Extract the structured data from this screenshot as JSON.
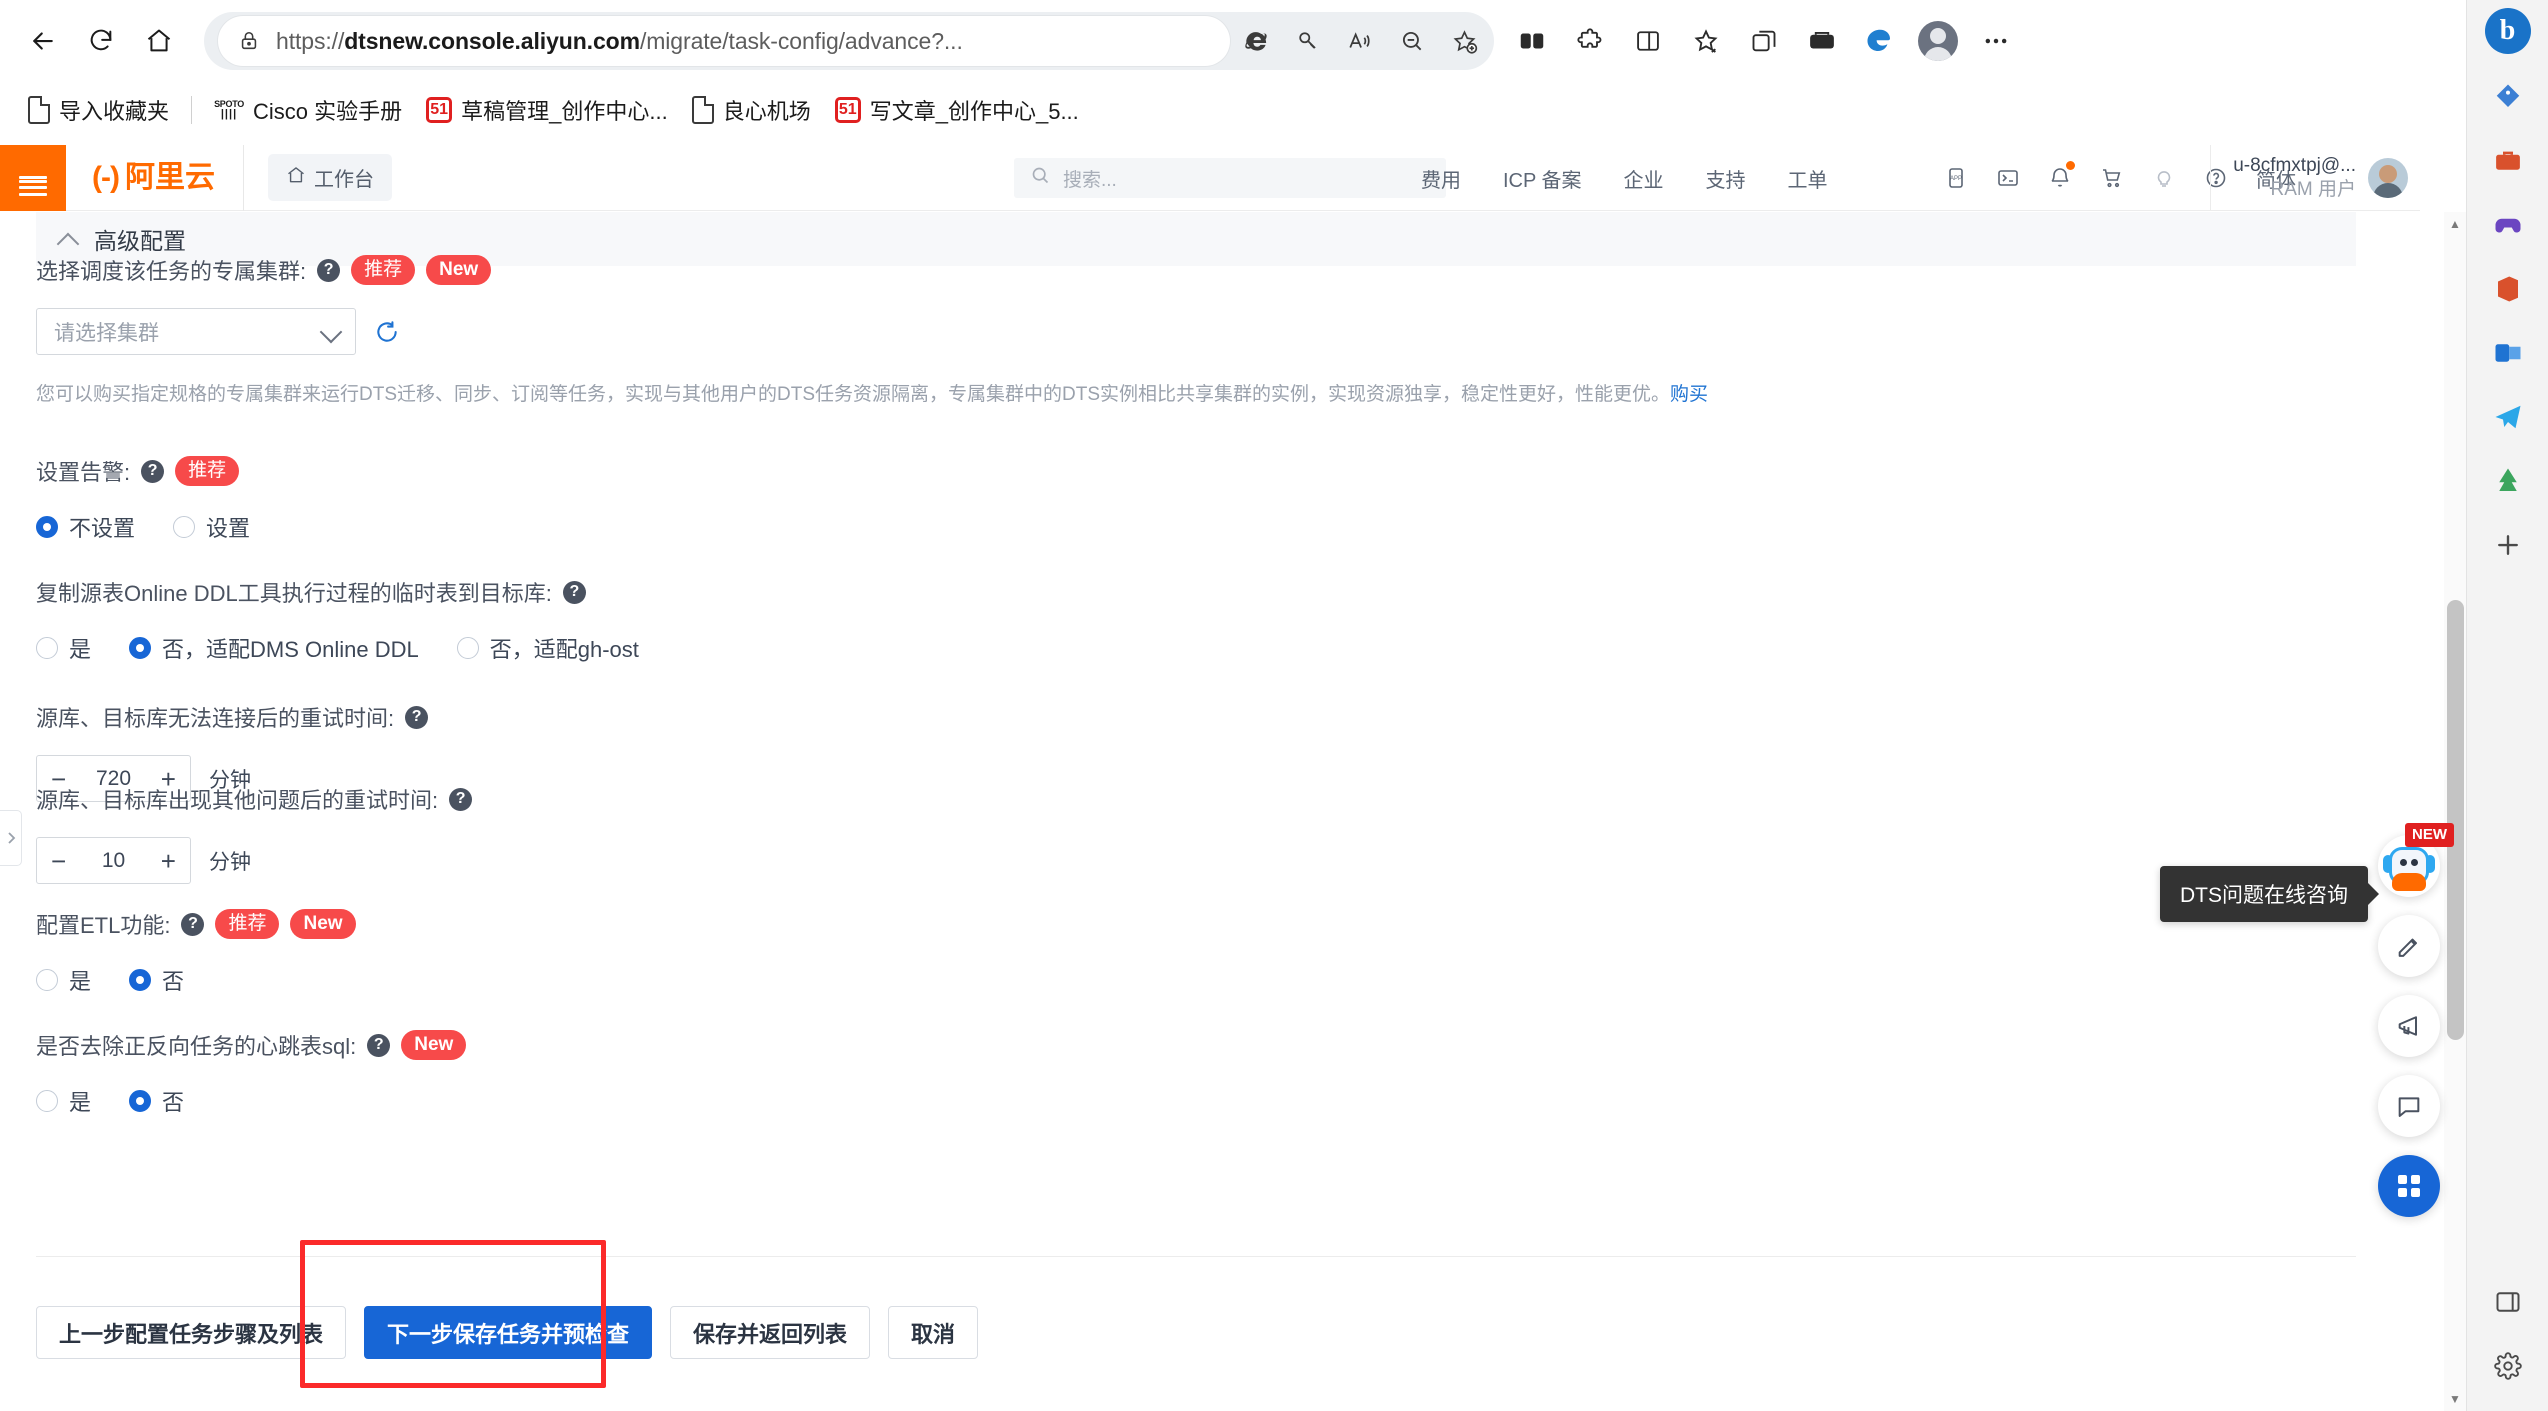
{
  "browser": {
    "url_prefix": "https://",
    "url_bold": "dtsnew.console.aliyun.com",
    "url_rest": "/migrate/task-config/advance?...",
    "back_icon": "back-arrow-icon",
    "reload_icon": "reload-icon",
    "home_icon": "home-icon",
    "lock_icon": "lock-icon",
    "ie_icon": "internet-explorer-icon",
    "key_icon": "key-icon",
    "read_aloud_icon": "read-aloud-icon",
    "zoom_out_icon": "zoom-out-icon",
    "favorite_icon": "add-favorite-icon",
    "collections_icon": "collections-icon",
    "extensions_icon": "extensions-icon",
    "split_screen_icon": "split-screen-icon",
    "favorites_icon": "favorites-icon",
    "add_tab_icon": "add-tab-icon",
    "browser_essentials_icon": "browser-essentials-icon",
    "edge_profile_icon": "edge-logo-icon",
    "profile_icon": "profile-avatar-icon",
    "settings_more_icon": "more-options-icon"
  },
  "bookmarks": [
    {
      "label": "导入收藏夹",
      "icon": "import-favorites-icon"
    },
    {
      "label": "Cisco 实验手册",
      "icon": "spoto-favicon"
    },
    {
      "label": "草稿管理_创作中心...",
      "icon": "51-favicon"
    },
    {
      "label": "良心机场",
      "icon": "document-favicon"
    },
    {
      "label": "写文章_创作中心_5...",
      "icon": "51-favicon"
    }
  ],
  "aliyun_header": {
    "menu_icon": "hamburger-menu-icon",
    "logo_text": "阿里云",
    "workbench": "工作台",
    "workbench_icon": "home-icon",
    "search_placeholder": "搜索...",
    "search_icon": "search-icon",
    "nav": [
      "费用",
      "ICP 备案",
      "企业",
      "支持",
      "工单"
    ],
    "icons": [
      "app-icon",
      "terminal-icon",
      "bell-icon",
      "cart-icon",
      "lightbulb-icon",
      "help-icon"
    ],
    "lang": "简体",
    "user_id": "u-8cfmxtpj@...",
    "user_role": "RAM 用户",
    "avatar": "user-avatar"
  },
  "page": {
    "section_title": "高级配置",
    "collapse_icon": "chevron-up-icon",
    "fields": {
      "cluster": {
        "label": "选择调度该任务的专属集群:",
        "tag_recommend": "推荐",
        "tag_new": "New",
        "select_value": "请选择集群",
        "refresh_icon": "refresh-icon",
        "description": "您可以购买指定规格的专属集群来运行DTS迁移、同步、订阅等任务，实现与其他用户的DTS任务资源隔离，专属集群中的DTS实例相比共享集群的实例，实现资源独享，稳定性更好，性能更优。",
        "description_link": "购买"
      },
      "alarm": {
        "label": "设置告警:",
        "tag_recommend": "推荐",
        "options": [
          {
            "label": "不设置",
            "checked": true
          },
          {
            "label": "设置",
            "checked": false
          }
        ]
      },
      "online_ddl": {
        "label": "复制源表Online DDL工具执行过程的临时表到目标库:",
        "options": [
          {
            "label": "是",
            "checked": false
          },
          {
            "label": "否，适配DMS Online DDL",
            "checked": true
          },
          {
            "label": "否，适配gh-ost",
            "checked": false
          }
        ]
      },
      "retry_connect": {
        "label": "源库、目标库无法连接后的重试时间:",
        "value": "720",
        "unit": "分钟",
        "minus": "−",
        "plus": "+"
      },
      "retry_other": {
        "label": "源库、目标库出现其他问题后的重试时间:",
        "value": "10",
        "unit": "分钟",
        "minus": "−",
        "plus": "+"
      },
      "etl": {
        "label": "配置ETL功能:",
        "tag_recommend": "推荐",
        "tag_new": "New",
        "options": [
          {
            "label": "是",
            "checked": false
          },
          {
            "label": "否",
            "checked": true
          }
        ]
      },
      "heartbeat": {
        "label": "是否去除正反向任务的心跳表sql:",
        "tag_new": "New",
        "options": [
          {
            "label": "是",
            "checked": false
          },
          {
            "label": "否",
            "checked": true
          }
        ]
      }
    },
    "buttons": {
      "prev": "上一步配置任务步骤及列表",
      "next": "下一步保存任务并预检查",
      "save_back": "保存并返回列表",
      "cancel": "取消"
    },
    "highlight_color": "#fb2a2a"
  },
  "floating": {
    "tooltip": "DTS问题在线咨询",
    "new_badge": "NEW",
    "robot_icon": "robot-assistant-icon",
    "pencil_icon": "pencil-icon",
    "megaphone_icon": "megaphone-icon",
    "chat_icon": "chat-bubble-icon",
    "grid_icon": "grid-apps-icon"
  },
  "edge_sidebar": {
    "items": [
      "bing-copilot-icon",
      "shopping-tag-icon",
      "briefcase-icon",
      "games-icon",
      "office-icon",
      "outlook-icon",
      "paper-plane-icon",
      "tree-icon",
      "add-icon",
      "drop-panel-icon",
      "settings-gear-icon"
    ]
  },
  "colors": {
    "aliyun_orange": "#FF6A00",
    "primary_blue": "#1766d6",
    "tag_red": "#f74a4a",
    "highlight_red": "#fb2a2a",
    "link_blue": "#1f73d2"
  }
}
